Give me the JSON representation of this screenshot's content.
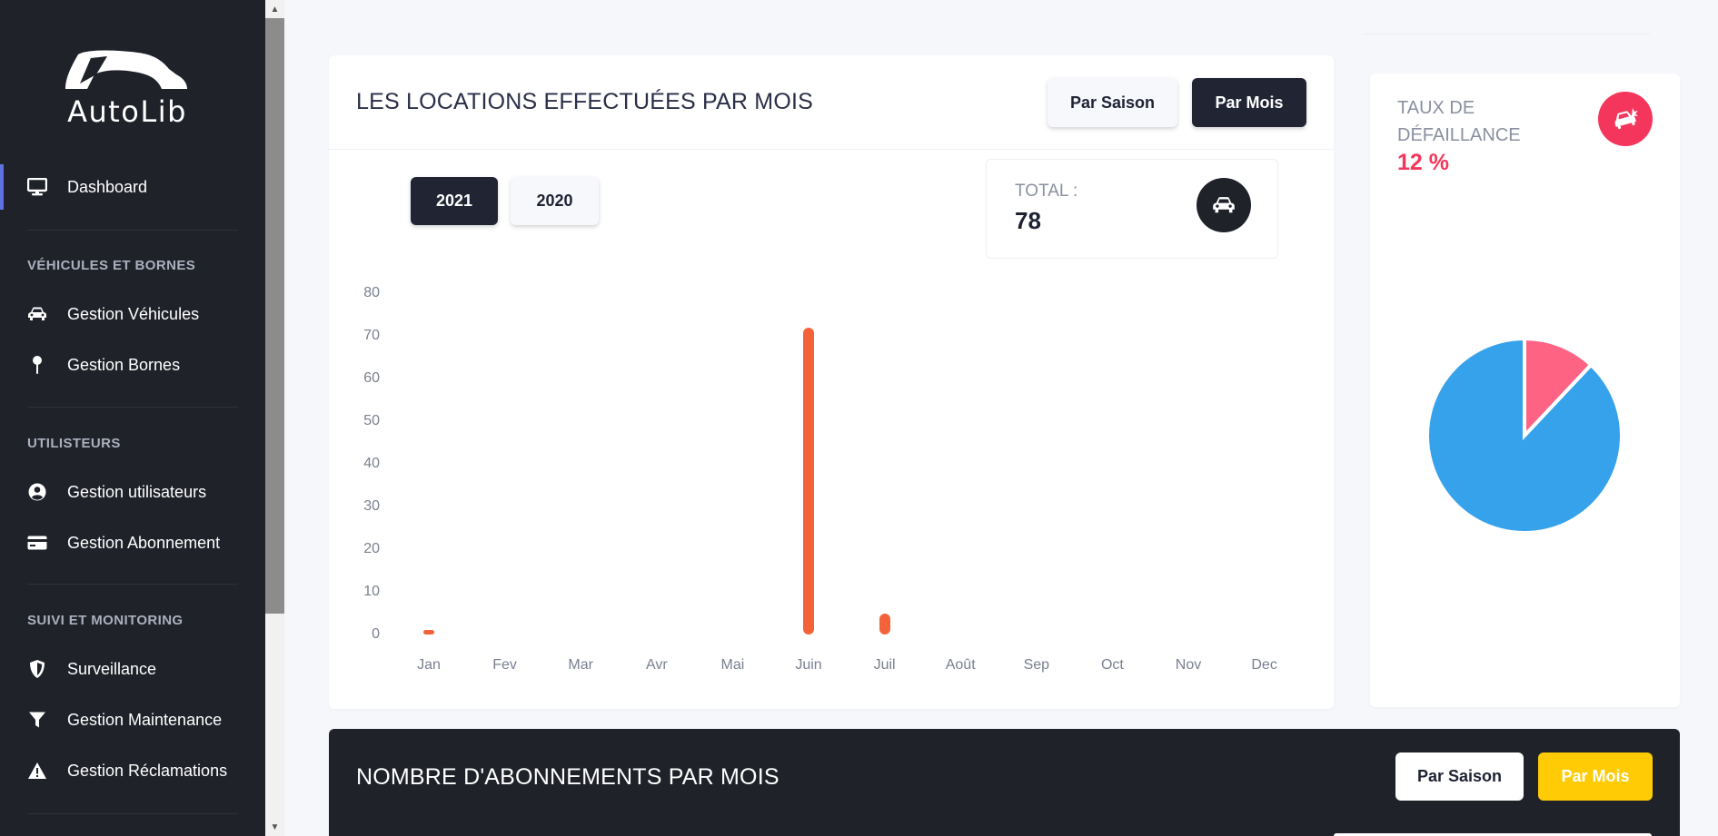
{
  "sidebar": {
    "logo_text": "AutoLib",
    "dashboard": "Dashboard",
    "section_vehicles": "VÉHICULES ET BORNES",
    "gestion_vehicules": "Gestion Véhicules",
    "gestion_bornes": "Gestion Bornes",
    "section_users": "UTILISTEURS",
    "gestion_utilisateurs": "Gestion utilisateurs",
    "gestion_abonnement": "Gestion Abonnement",
    "section_monitoring": "SUIVI ET MONITORING",
    "surveillance": "Surveillance",
    "gestion_maintenance": "Gestion Maintenance",
    "gestion_reclamations": "Gestion Réclamations"
  },
  "locations_card": {
    "title": "LES LOCATIONS EFFECTUÉES PAR MOIS",
    "btn_saison": "Par Saison",
    "btn_mois": "Par Mois",
    "year_2021": "2021",
    "year_2020": "2020",
    "total_label": "TOTAL :",
    "total_value": "78"
  },
  "failure_card": {
    "title_line1": "TAUX DE",
    "title_line2": "DÉFAILLANCE",
    "value": "12 %"
  },
  "subs_card": {
    "title": "NOMBRE D'ABONNEMENTS PAR MOIS",
    "btn_saison": "Par Saison",
    "btn_mois": "Par Mois"
  },
  "colors": {
    "sidebar_bg": "#1f2229",
    "bar": "#f4623a",
    "pie_main": "#36a2eb",
    "pie_slice": "#ff6384",
    "danger": "#f5365c",
    "yellow": "#ffcb05"
  },
  "chart_data": [
    {
      "type": "bar",
      "categories": [
        "Jan",
        "Fev",
        "Mar",
        "Avr",
        "Mai",
        "Juin",
        "Juil",
        "Août",
        "Sep",
        "Oct",
        "Nov",
        "Dec"
      ],
      "values": [
        1,
        0,
        0,
        0,
        0,
        72,
        5,
        0,
        0,
        0,
        0,
        0
      ],
      "ylim": [
        0,
        80
      ],
      "yticks": [
        "0",
        "10",
        "20",
        "30",
        "40",
        "50",
        "60",
        "70",
        "80"
      ],
      "grid": false,
      "legend": "none"
    },
    {
      "type": "pie",
      "values": [
        88,
        12
      ],
      "colors": [
        "#36a2eb",
        "#ff6384"
      ]
    }
  ]
}
